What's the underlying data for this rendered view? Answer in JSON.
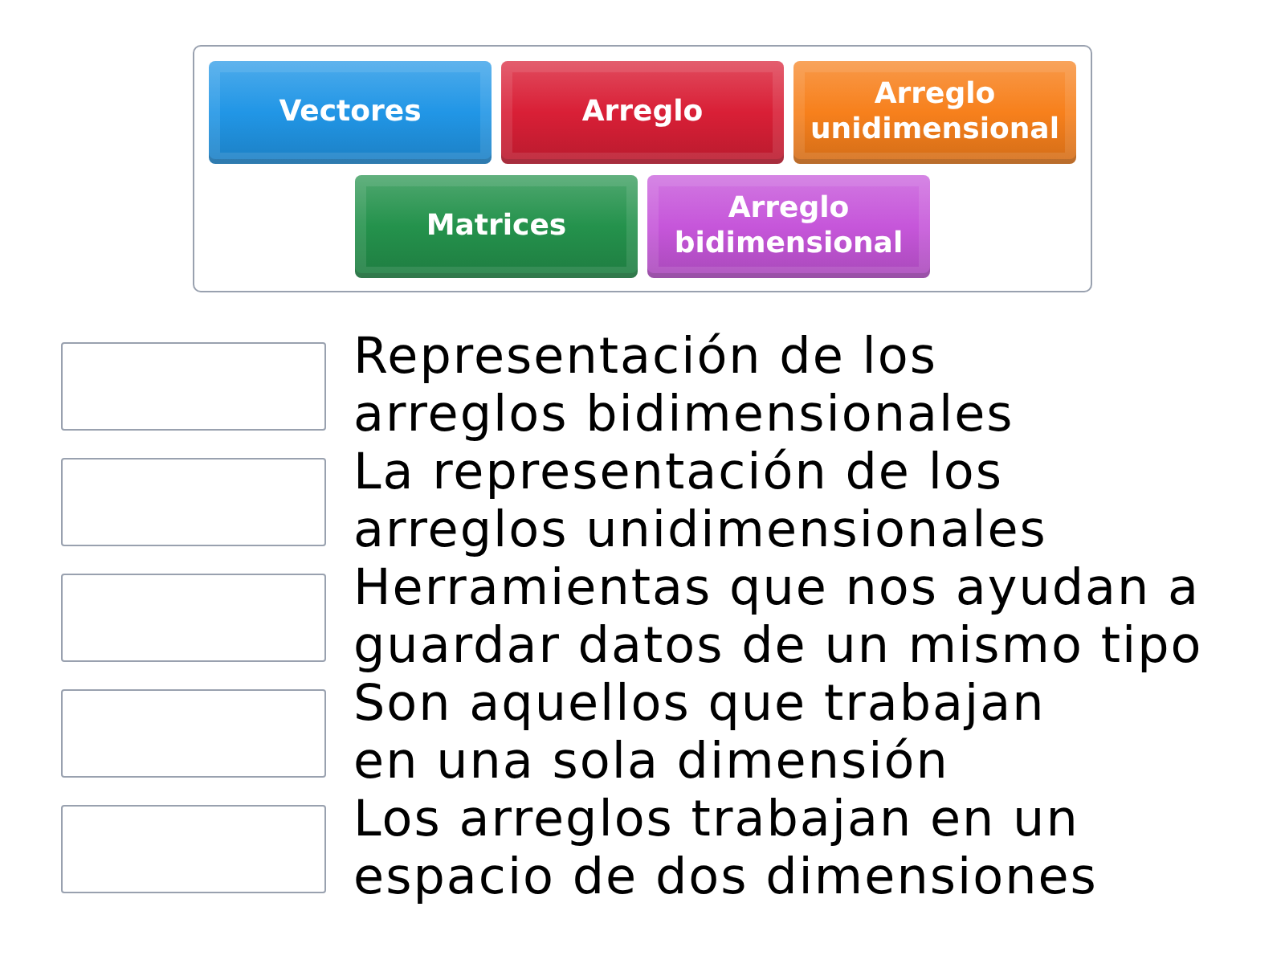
{
  "tiles": [
    {
      "label": "Vectores",
      "color": "#2196e6"
    },
    {
      "label": "Arreglo",
      "color": "#d91f36"
    },
    {
      "label": "Arreglo unidimensional",
      "color": "#f7801c"
    },
    {
      "label": "Matrices",
      "color": "#24924c"
    },
    {
      "label": "Arreglo bidimensional",
      "color": "#c656da"
    }
  ],
  "prompts": [
    {
      "lines": [
        "Representación de los",
        "arreglos bidimensionales"
      ]
    },
    {
      "lines": [
        "La representación de los",
        "arreglos unidimensionales"
      ]
    },
    {
      "lines": [
        "Herramientas que nos ayudan a",
        "guardar datos de un mismo tipo"
      ]
    },
    {
      "lines": [
        "Son aquellos que trabajan",
        "en una sola dimensión"
      ]
    },
    {
      "lines": [
        "Los arreglos trabajan en un",
        "espacio de dos dimensiones"
      ]
    }
  ]
}
